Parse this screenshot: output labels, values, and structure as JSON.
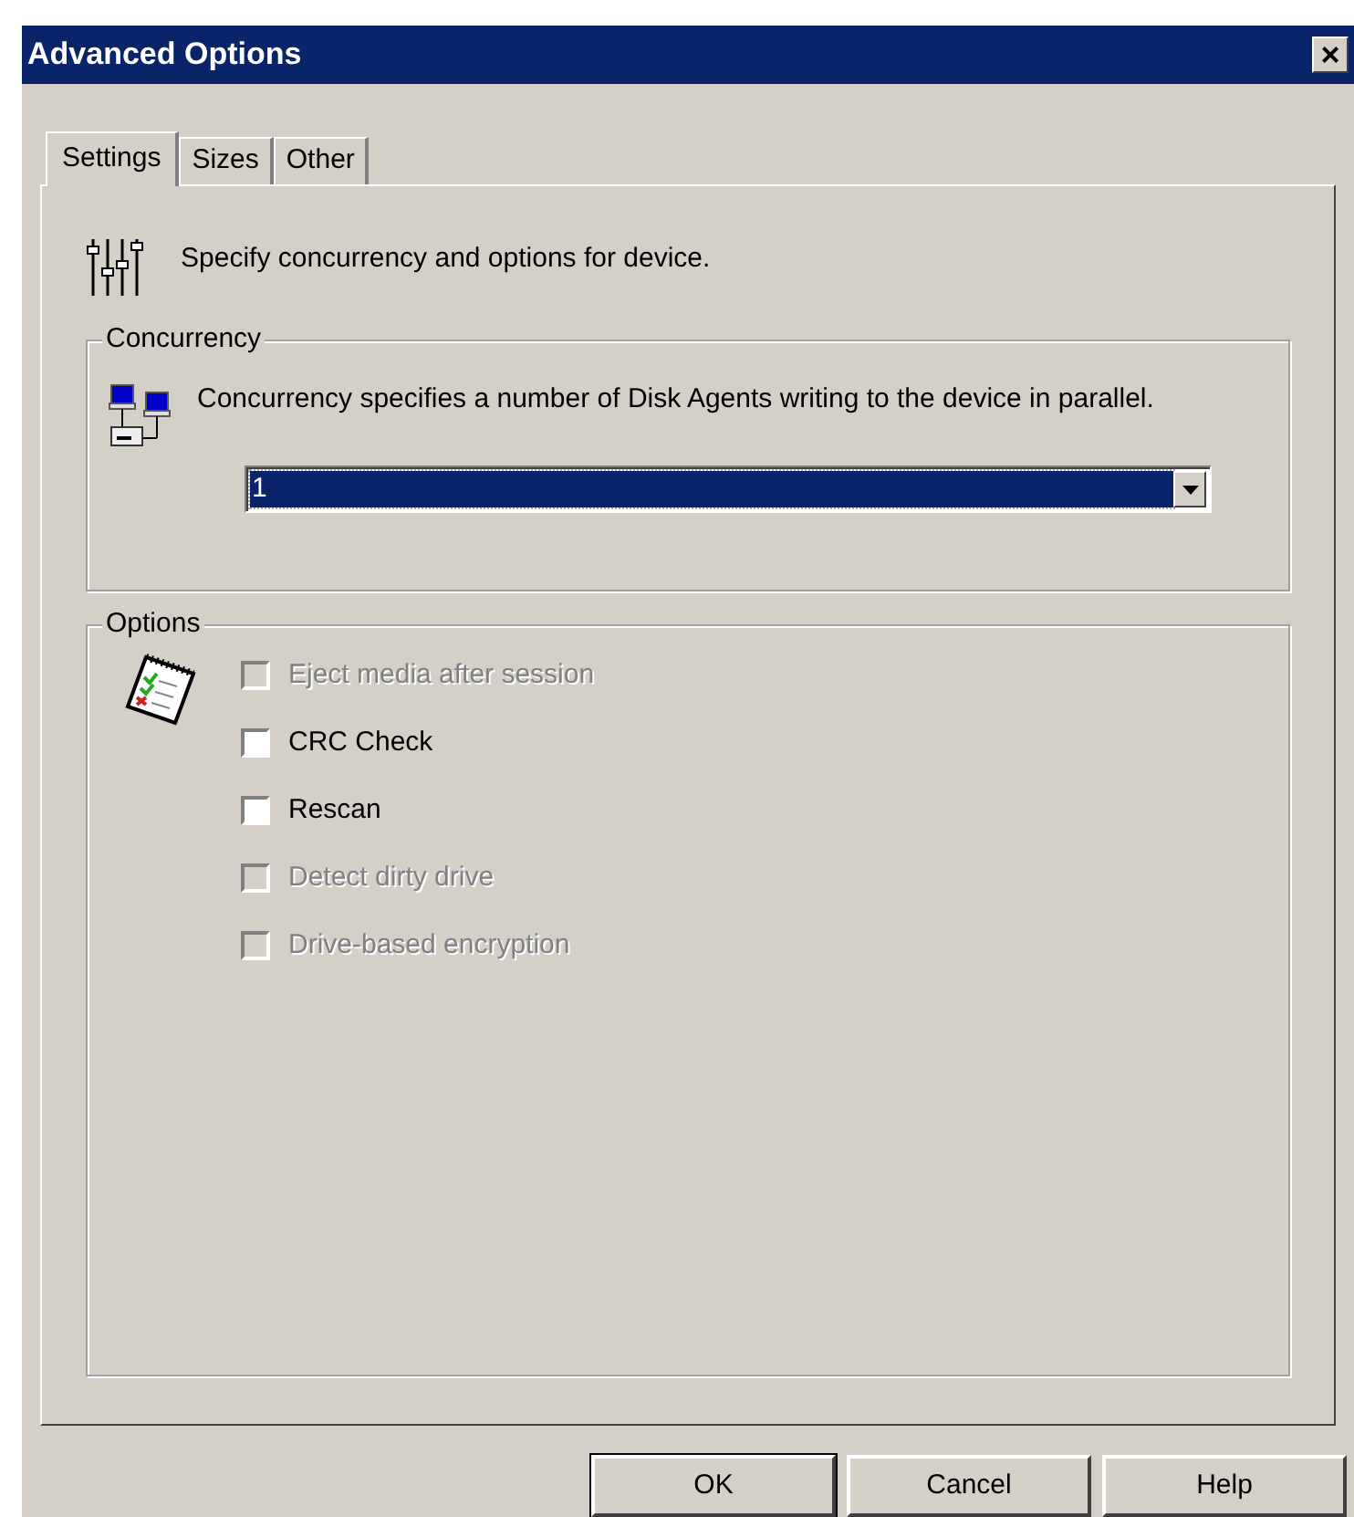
{
  "window": {
    "title": "Advanced Options",
    "close": "×"
  },
  "tabs": [
    {
      "label": "Settings",
      "selected": true
    },
    {
      "label": "Sizes",
      "selected": false
    },
    {
      "label": "Other",
      "selected": false
    }
  ],
  "intro": "Specify concurrency and options for device.",
  "concurrency": {
    "title": "Concurrency",
    "description": "Concurrency specifies a number of Disk Agents writing to the device in parallel.",
    "value": "1",
    "focused": true
  },
  "options": {
    "title": "Options",
    "items": [
      {
        "label": "Eject media after session",
        "checked": false,
        "disabled": true
      },
      {
        "label": "CRC Check",
        "checked": false,
        "disabled": false
      },
      {
        "label": "Rescan",
        "checked": false,
        "disabled": false
      },
      {
        "label": "Detect dirty drive",
        "checked": false,
        "disabled": true
      },
      {
        "label": "Drive-based encryption",
        "checked": false,
        "disabled": true
      }
    ]
  },
  "buttons": [
    {
      "label": "OK",
      "default": true
    },
    {
      "label": "Cancel",
      "default": false
    },
    {
      "label": "Help",
      "default": false
    }
  ]
}
